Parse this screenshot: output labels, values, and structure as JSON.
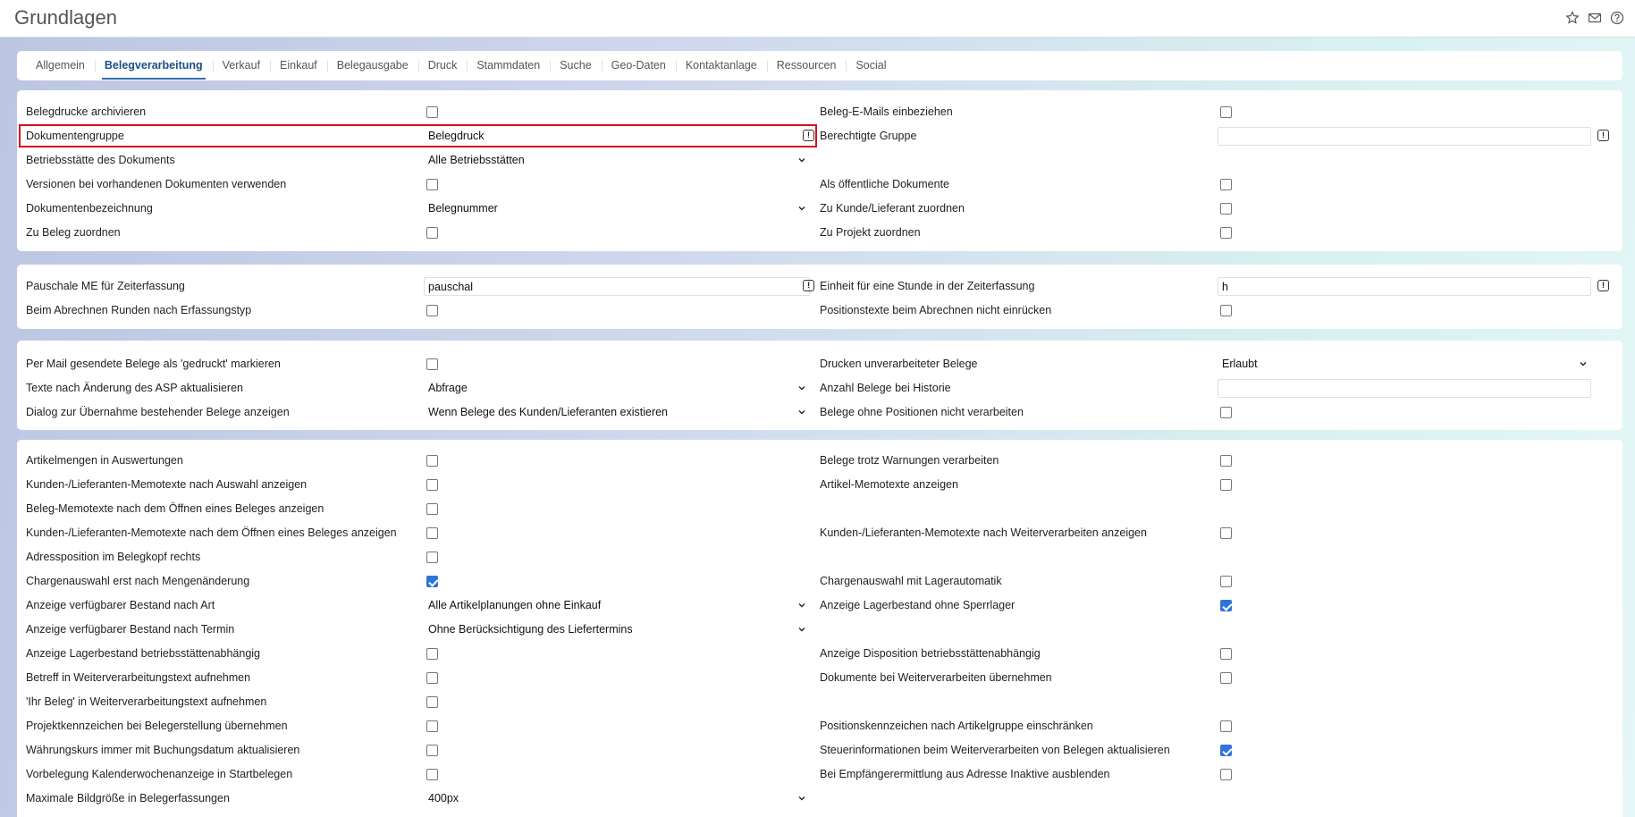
{
  "page": {
    "title": "Grundlagen"
  },
  "tabs": [
    "Allgemein",
    "Belegverarbeitung",
    "Verkauf",
    "Einkauf",
    "Belegausgabe",
    "Druck",
    "Stammdaten",
    "Suche",
    "Geo-Daten",
    "Kontaktanlage",
    "Ressourcen",
    "Social"
  ],
  "active_tab": "Belegverarbeitung",
  "section1": {
    "belegdrucke_archivieren": "Belegdrucke archivieren",
    "beleg_emails": "Beleg-E-Mails einbeziehen",
    "dokumentengruppe": "Dokumentengruppe",
    "dokumentengruppe_value": "Belegdruck",
    "berechtigte_gruppe": "Berechtigte Gruppe",
    "berechtigte_gruppe_value": "",
    "betriebsstaette": "Betriebsstätte des Dokuments",
    "betriebsstaette_value": "Alle Betriebsstätten",
    "versionen": "Versionen bei vorhandenen Dokumenten verwenden",
    "oeffentliche": "Als öffentliche Dokumente",
    "dokumentenbezeichnung": "Dokumentenbezeichnung",
    "dokumentenbezeichnung_value": "Belegnummer",
    "kunde_lieferant": "Zu Kunde/Lieferant zuordnen",
    "zu_beleg": "Zu Beleg zuordnen",
    "zu_projekt": "Zu Projekt zuordnen"
  },
  "section2": {
    "pauschale": "Pauschale ME für Zeiterfassung",
    "pauschale_value": "pauschal",
    "einheit": "Einheit für eine Stunde in der Zeiterfassung",
    "einheit_value": "h",
    "runden": "Beim Abrechnen Runden nach Erfassungstyp",
    "positionstexte": "Positionstexte beim Abrechnen nicht einrücken"
  },
  "section3": {
    "per_mail": "Per Mail gesendete Belege als 'gedruckt' markieren",
    "drucken_unverarbeiteter": "Drucken unverarbeiteter Belege",
    "drucken_value": "Erlaubt",
    "texte_asp": "Texte nach Änderung des ASP aktualisieren",
    "texte_asp_value": "Abfrage",
    "anzahl_historie": "Anzahl Belege bei Historie",
    "anzahl_historie_value": "",
    "dialog_uebernahme": "Dialog zur Übernahme bestehender Belege anzeigen",
    "dialog_value": "Wenn Belege des Kunden/Lieferanten existieren",
    "ohne_positionen": "Belege ohne Positionen nicht verarbeiten"
  },
  "section4": {
    "artikelmengen": "Artikelmengen in Auswertungen",
    "trotz_warnungen": "Belege trotz Warnungen verarbeiten",
    "kunden_memo_auswahl": "Kunden-/Lieferanten-Memotexte nach Auswahl anzeigen",
    "artikel_memo": "Artikel-Memotexte anzeigen",
    "beleg_memo": "Beleg-Memotexte nach dem Öffnen eines Beleges anzeigen",
    "kunden_memo_oeffnen": "Kunden-/Lieferanten-Memotexte nach dem Öffnen eines Beleges anzeigen",
    "kunden_memo_weiter": "Kunden-/Lieferanten-Memotexte nach Weiterverarbeiten anzeigen",
    "adressposition": "Adressposition im Belegkopf rechts",
    "chargen_menge": "Chargenauswahl erst nach Mengenänderung",
    "chargen_lager": "Chargenauswahl mit Lagerautomatik",
    "bestand_art": "Anzeige verfügbarer Bestand nach Art",
    "bestand_art_value": "Alle Artikelplanungen ohne Einkauf",
    "lager_ohne_sperr": "Anzeige Lagerbestand ohne Sperrlager",
    "bestand_termin": "Anzeige verfügbarer Bestand nach Termin",
    "bestand_termin_value": "Ohne Berücksichtigung des Liefertermins",
    "lager_betrieb": "Anzeige Lagerbestand betriebsstättenabhängig",
    "disposition_betrieb": "Anzeige Disposition betriebsstättenabhängig",
    "betreff": "Betreff in Weiterverarbeitungstext aufnehmen",
    "dokumente_weiter": "Dokumente bei Weiterverarbeiten übernehmen",
    "ihr_beleg": "'Ihr Beleg' in Weiterverarbeitungstext aufnehmen",
    "projektkennzeichen": "Projektkennzeichen bei Belegerstellung übernehmen",
    "positionskennzeichen": "Positionskennzeichen nach Artikelgruppe einschränken",
    "waehrungskurs": "Währungskurs immer mit Buchungsdatum aktualisieren",
    "steuerinformationen": "Steuerinformationen beim Weiterverarbeiten von Belegen aktualisieren",
    "kalenderwoche": "Vorbelegung Kalenderwochenanzeige in Startbelegen",
    "empfaenger": "Bei Empfängerermittlung aus Adresse Inaktive ausblenden",
    "bildgroesse": "Maximale Bildgröße in Belegerfassungen",
    "bildgroesse_value": "400px"
  },
  "colors": {
    "accent": "#2f74d8",
    "highlight": "#d6101a",
    "tab_active": "#1a4f8a"
  },
  "icons": [
    "star-icon",
    "mail-icon",
    "help-icon",
    "info-icon",
    "chevron-down-icon"
  ]
}
